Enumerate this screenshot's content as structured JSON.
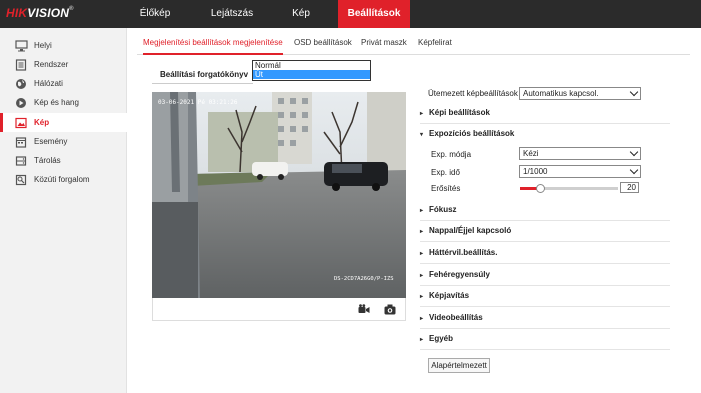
{
  "brand": {
    "logo_red": "HIK",
    "logo_white": "VISION",
    "reg": "®",
    "accent": "#e0212a"
  },
  "topnav": {
    "items": [
      {
        "label": "Élőkép"
      },
      {
        "label": "Lejátszás"
      },
      {
        "label": "Kép"
      },
      {
        "label": "Beállítások"
      }
    ],
    "active": "Beállítások"
  },
  "sidebar": {
    "items": [
      {
        "label": "Helyi",
        "icon": "monitor-icon"
      },
      {
        "label": "Rendszer",
        "icon": "system-icon"
      },
      {
        "label": "Hálózati",
        "icon": "globe-icon"
      },
      {
        "label": "Kép és hang",
        "icon": "media-icon"
      },
      {
        "label": "Kép",
        "icon": "image-icon"
      },
      {
        "label": "Esemény",
        "icon": "event-icon"
      },
      {
        "label": "Tárolás",
        "icon": "storage-icon"
      },
      {
        "label": "Közúti forgalom",
        "icon": "traffic-icon"
      }
    ],
    "active": "Kép"
  },
  "tabs": {
    "items": [
      {
        "label": "Megjelenítési beállítások megjelenítése"
      },
      {
        "label": "OSD beállítások"
      },
      {
        "label": "Privát maszk"
      },
      {
        "label": "Képfelirat"
      }
    ],
    "active": "Megjelenítési beállítások megjelenítése"
  },
  "scenario": {
    "label": "Beállítási forgatókönyv",
    "options": [
      "Normál",
      "Út"
    ],
    "selected": "Út"
  },
  "video": {
    "osd_time": "03-06-2021 Pé 03:21:26",
    "osd_name": "DS-2CD7A26G0/P-IZS"
  },
  "settings": {
    "schedule_label": "Ütemezett képbeállítások",
    "schedule_value": "Automatikus kapcsol.",
    "image_section": "Képi beállítások",
    "exposure_section": "Expozíciós beállítások",
    "exp_mode_label": "Exp. módja",
    "exp_mode_value": "Kézi",
    "exp_time_label": "Exp. idő",
    "exp_time_value": "1/1000",
    "gain_label": "Erősítés",
    "gain_value": "20",
    "sections": [
      {
        "label": "Fókusz"
      },
      {
        "label": "Nappal/Éjjel kapcsoló"
      },
      {
        "label": "Háttérvil.beállítás."
      },
      {
        "label": "Fehéregyensúly"
      },
      {
        "label": "Képjavítás"
      },
      {
        "label": "Videobeállítás"
      },
      {
        "label": "Egyéb"
      }
    ],
    "default_button": "Alapértelmezett"
  }
}
